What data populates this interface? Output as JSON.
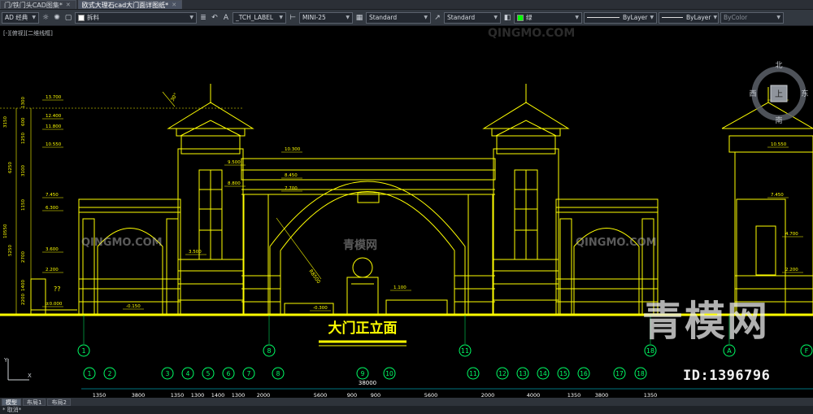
{
  "tabs": [
    {
      "label": "门/铁门头CAD图集*",
      "active": false
    },
    {
      "label": "欧式大理石cad大门面详图纸*",
      "active": true
    }
  ],
  "toolbar": {
    "workspace": "AD 经典",
    "layer": "拆料",
    "text_style": "_TCH_LABEL",
    "dim_style": "MINI-25",
    "table_style": "Standard",
    "multileader_style": "Standard",
    "color": "绿",
    "linetype": "ByLayer",
    "lineweight": "ByLayer",
    "plotstyle": "ByColor"
  },
  "viewport_label": "[-][俯视][二维线框]",
  "viewcube": {
    "north": "北",
    "south": "南",
    "east": "东",
    "west": "西",
    "face": "上"
  },
  "drawing": {
    "title": "大门正立面",
    "level_labels": [
      "13.700",
      "12.400",
      "11.800",
      "10.550",
      "7.450",
      "6.300",
      "3.600",
      "2.200",
      "±0.000",
      "10.300",
      "8.450",
      "7.700",
      "9.500",
      "8.800",
      "3.500",
      "1.100",
      "-0.150",
      "-0.300",
      "13.700",
      "10.550",
      "7.450",
      "4.700",
      "2.200"
    ],
    "left_dims": [
      "3150",
      "1300",
      "600",
      "1250",
      "6250",
      "3100",
      "1150",
      "10550",
      "5250",
      "2700",
      "1400",
      "2200"
    ],
    "slope_label": "30°",
    "radius_label": "R8500",
    "q_label": "??",
    "axis_markers_top": [
      "1",
      "8",
      "11",
      "18",
      "A",
      "F"
    ],
    "axis_markers_bottom": [
      "1",
      "2",
      "3",
      "4",
      "5",
      "6",
      "7",
      "8",
      "9",
      "10",
      "11",
      "12",
      "13",
      "14",
      "15",
      "16",
      "17",
      "18"
    ],
    "dim_segments": [
      "1350",
      "3800",
      "1350",
      "1300",
      "1400",
      "1300",
      "2000",
      "5600",
      "900",
      "900",
      "5600",
      "2000",
      "4000",
      "1350",
      "3800",
      "1350"
    ],
    "overall_dim": "38000"
  },
  "watermarks": {
    "logo": "QINGMO.COM",
    "cn_small": "青模网",
    "cn_large": "青模网",
    "id": "ID:1396796"
  },
  "layout_tabs": [
    {
      "label": "模型",
      "active": true
    },
    {
      "label": "布局1",
      "active": false
    },
    {
      "label": "布局2",
      "active": false
    }
  ],
  "command_line": "* 取消*",
  "colors": {
    "line": "#ffff00",
    "axis": "#00ff66",
    "dim": "#00e5ff",
    "bg": "#000000"
  }
}
